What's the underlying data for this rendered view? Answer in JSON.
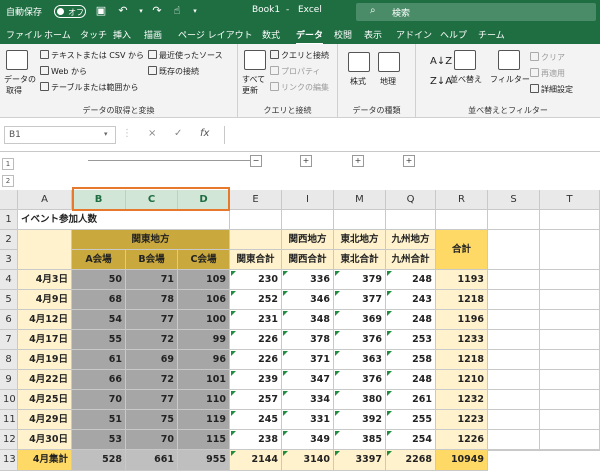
{
  "titlebar": {
    "autosave": "自動保存",
    "toggle": "オフ",
    "book": "Book1",
    "sep": "-",
    "app": "Excel",
    "search": "検索"
  },
  "tabs": [
    "ファイル",
    "ホーム",
    "タッチ",
    "挿入",
    "描画",
    "ページ レイアウト",
    "数式",
    "データ",
    "校閲",
    "表示",
    "アドイン",
    "ヘルプ",
    "チーム"
  ],
  "active_tab": "データ",
  "ribbon": {
    "get_data": {
      "big": "データの",
      "big2": "取得",
      "csv": "テキストまたは CSV から",
      "web": "Web から",
      "table": "テーブルまたは範囲から",
      "recent": "最近使ったソース",
      "existing": "既存の接続",
      "label": "データの取得と変換"
    },
    "queries": {
      "refresh": "すべて",
      "refresh2": "更新",
      "qc": "クエリと接続",
      "props": "プロパティ",
      "links": "リンクの編集",
      "label": "クエリと接続"
    },
    "types": {
      "stocks": "株式",
      "geo": "地理",
      "label": "データの種類"
    },
    "sort": {
      "sort": "並べ替え",
      "filter": "フィルター",
      "clear": "クリア",
      "reapply": "再適用",
      "advanced": "詳細設定",
      "label": "並べ替えとフィルター"
    }
  },
  "formula": {
    "namebox": "B1",
    "cancel": "×",
    "enter": "✓",
    "fx": "fx",
    "value": ""
  },
  "outline": {
    "levels": [
      "1",
      "2"
    ],
    "minus": "−",
    "plus": "+"
  },
  "columns": [
    "A",
    "B",
    "C",
    "D",
    "E",
    "I",
    "M",
    "Q",
    "R",
    "S",
    "T"
  ],
  "rows": [
    "1",
    "2",
    "3",
    "4",
    "5",
    "6",
    "7",
    "8",
    "9",
    "10",
    "11",
    "12",
    "13"
  ],
  "sheet": {
    "title": "イベント参加人数",
    "kanto": "関東地方",
    "kansai": "関西地方",
    "tohoku": "東北地方",
    "kyushu": "九州地方",
    "total": "合計",
    "sub": [
      "A会場",
      "B会場",
      "C会場",
      "関東合計",
      "関西合計",
      "東北合計",
      "九州合計"
    ],
    "data": [
      [
        "4月3日",
        "50",
        "71",
        "109",
        "230",
        "336",
        "379",
        "248",
        "1193"
      ],
      [
        "4月9日",
        "68",
        "78",
        "106",
        "252",
        "346",
        "377",
        "243",
        "1218"
      ],
      [
        "4月12日",
        "54",
        "77",
        "100",
        "231",
        "348",
        "369",
        "248",
        "1196"
      ],
      [
        "4月17日",
        "55",
        "72",
        "99",
        "226",
        "378",
        "376",
        "253",
        "1233"
      ],
      [
        "4月19日",
        "61",
        "69",
        "96",
        "226",
        "371",
        "363",
        "258",
        "1218"
      ],
      [
        "4月22日",
        "66",
        "72",
        "101",
        "239",
        "347",
        "376",
        "248",
        "1210"
      ],
      [
        "4月25日",
        "70",
        "77",
        "110",
        "257",
        "334",
        "380",
        "261",
        "1232"
      ],
      [
        "4月29日",
        "51",
        "75",
        "119",
        "245",
        "331",
        "392",
        "255",
        "1223"
      ],
      [
        "4月30日",
        "53",
        "70",
        "115",
        "238",
        "349",
        "385",
        "254",
        "1226"
      ],
      [
        "4月集計",
        "528",
        "661",
        "955",
        "2144",
        "3140",
        "3397",
        "2268",
        "10949"
      ]
    ]
  }
}
